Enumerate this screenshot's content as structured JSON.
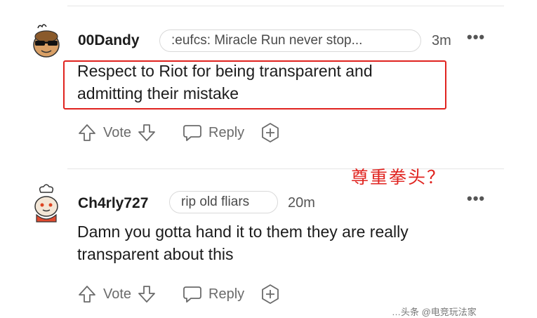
{
  "comments": [
    {
      "username": "00Dandy",
      "flair": ":eufcs: Miracle Run never stop...",
      "time": "3m",
      "more": "•••",
      "body_line1": "Respect to Riot for being transparent and",
      "body_line2": "admitting their mistake",
      "actions": {
        "vote": "Vote",
        "reply": "Reply"
      }
    },
    {
      "username": "Ch4rly727",
      "flair": "rip old fliars",
      "time": "20m",
      "more": "•••",
      "body_line1": "Damn you gotta hand it to them they are really",
      "body_line2": "transparent about this",
      "actions": {
        "vote": "Vote",
        "reply": "Reply"
      }
    }
  ],
  "annotation": "尊重拳头？",
  "watermark": "…头条 @电竞玩法家",
  "colors": {
    "annotation_red": "#e0231f",
    "text": "#1c1c1c",
    "muted": "#6b6b6b"
  },
  "icons": [
    "snoo-avatar-sunglasses",
    "snoo-avatar-chef",
    "upvote-arrow-icon",
    "downvote-arrow-icon",
    "reply-bubble-icon",
    "award-plus-icon",
    "more-dots-icon"
  ]
}
